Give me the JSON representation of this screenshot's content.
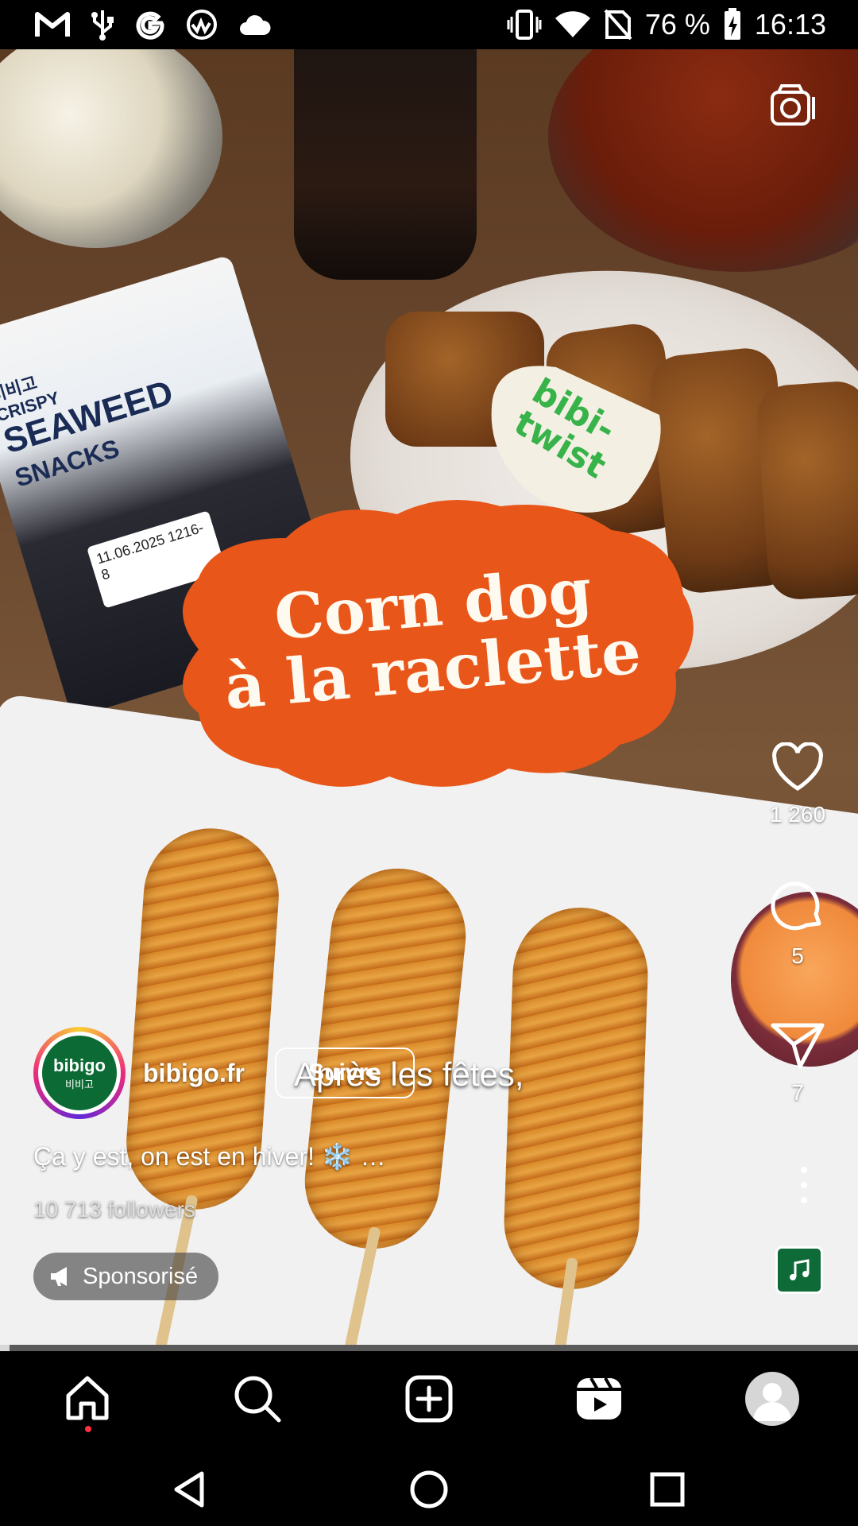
{
  "status_bar": {
    "battery": "76 %",
    "time": "16:13",
    "left_icons": [
      "gmail-icon",
      "usb-icon",
      "google-icon",
      "vpn-globe-icon",
      "cloud-icon"
    ],
    "right_icons": [
      "vibrate-icon",
      "wifi-icon",
      "no-sim-icon",
      "battery-charging-icon"
    ]
  },
  "video": {
    "overlay_title_line1": "Corn dog",
    "overlay_title_line2": "à la raclette",
    "sticker_text_line1": "bibi-",
    "sticker_text_line2": "twist",
    "subtitle": "Après les fêtes,",
    "package_brand_small": "비비고",
    "package_crispy": "CRISPY",
    "package_title1": "SEAWEED",
    "package_title2": "SNACKS",
    "package_label": "11.06.2025 1216-8",
    "progress": 0.011
  },
  "actions": {
    "likes": "1 260",
    "comments": "5",
    "shares": "7"
  },
  "creator": {
    "username": "bibigo.fr",
    "follow_label": "Suivre",
    "avatar_text": "bibigo",
    "avatar_subtext": "비비고",
    "caption": "Ça y est, on est en hiver! ❄️ …",
    "followers": "10 713 followers",
    "sponsored_label": "Sponsorisé"
  },
  "accent_colors": {
    "blob_orange": "#e8561a",
    "sticker_green": "#37b34a",
    "notification_dot": "#ff3040"
  },
  "bottom_nav": [
    "home-icon",
    "search-icon",
    "create-icon",
    "reels-icon",
    "profile-avatar"
  ],
  "system_nav": [
    "back-button",
    "home-button",
    "recents-button"
  ]
}
